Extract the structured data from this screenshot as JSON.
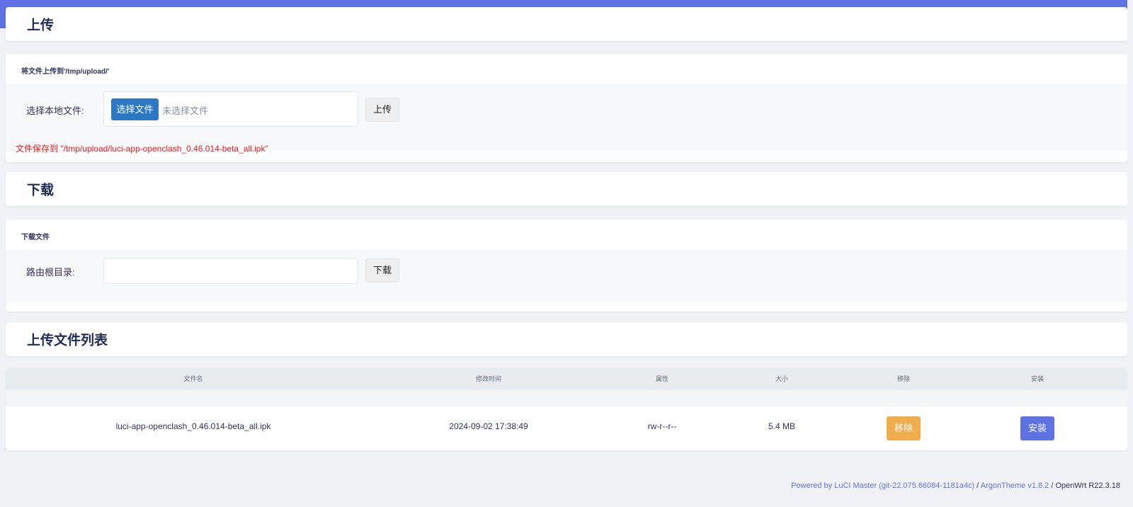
{
  "upload": {
    "title": "上传",
    "legend": "将文件上传到'/tmp/upload/'",
    "label": "选择本地文件:",
    "choose_button": "选择文件",
    "file_status": "未选择文件",
    "upload_button": "上传",
    "saved_message": "文件保存到 \"/tmp/upload/luci-app-openclash_0.46.014-beta_all.ipk\""
  },
  "download": {
    "title": "下载",
    "legend": "下载文件",
    "label": "路由根目录:",
    "input_value": "",
    "download_button": "下载"
  },
  "file_list": {
    "title": "上传文件列表",
    "columns": [
      "文件名",
      "修改时间",
      "属性",
      "大小",
      "移除",
      "安装"
    ],
    "rows": [
      {
        "name": "luci-app-openclash_0.46.014-beta_all.ipk",
        "modified": "2024-09-02 17:38:49",
        "attributes": "rw-r--r--",
        "size": "5.4 MB",
        "remove_label": "移除",
        "install_label": "安装"
      }
    ]
  },
  "colors": {
    "accent": "#5e72e4",
    "remove_button": "#f0ad4e",
    "install_button": "#5e72e4",
    "choose_button": "#2d78c4",
    "message": "#ee1c1c"
  },
  "footer": {
    "powered_by": "Powered by LuCI Master (git-22.075.66084-1181a4c)",
    "separator1": " / ",
    "theme": "ArgonTheme v1.8.2",
    "separator2": " / ",
    "os": "OpenWrt R22.3.18"
  }
}
